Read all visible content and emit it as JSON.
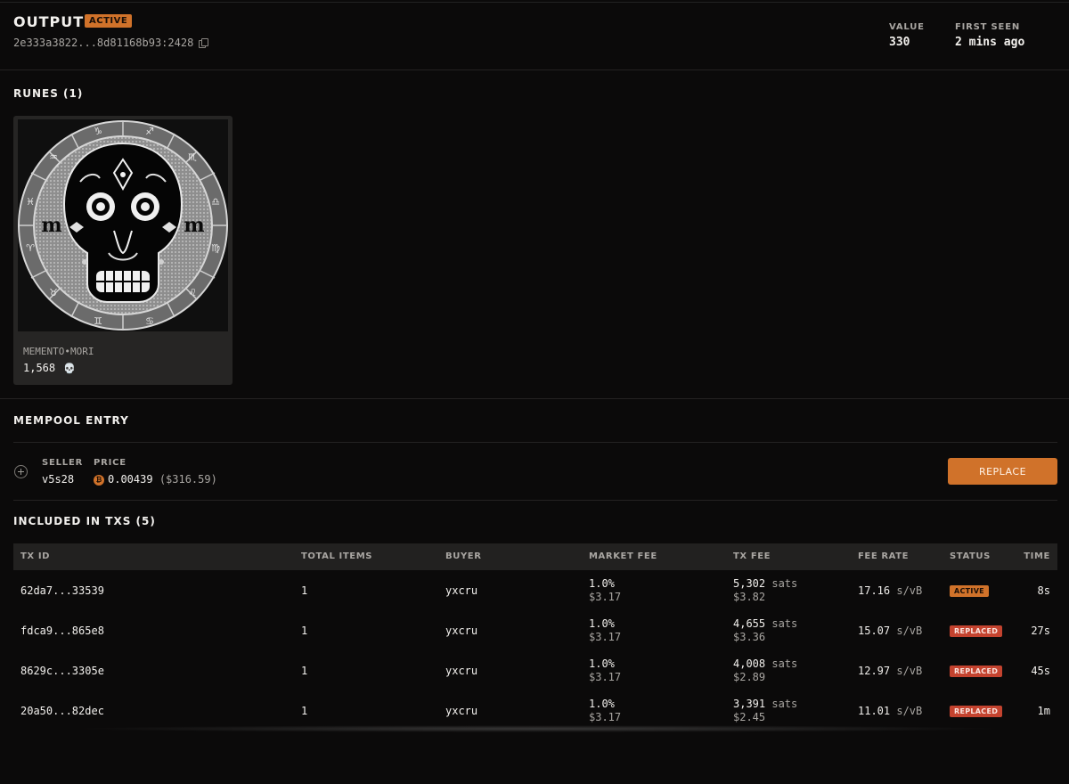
{
  "header": {
    "title": "OUTPUT",
    "status": "ACTIVE",
    "address": "2e333a3822...8d81168b93:2428",
    "value_label": "VALUE",
    "value": "330",
    "first_seen_label": "FIRST SEEN",
    "first_seen": "2 mins ago"
  },
  "runes": {
    "title": "RUNES (1)",
    "items": [
      {
        "name": "MEMENTO•MORI",
        "amount": "1,568",
        "symbol": "💀"
      }
    ]
  },
  "mempool": {
    "title": "MEMPOOL ENTRY",
    "seller_label": "SELLER",
    "seller": "v5s28",
    "price_label": "PRICE",
    "price_btc": "0.00439",
    "price_usd": "($316.59)",
    "replace_label": "REPLACE"
  },
  "txs": {
    "title": "INCLUDED IN TXS (5)",
    "columns": [
      "TX ID",
      "TOTAL ITEMS",
      "BUYER",
      "MARKET FEE",
      "TX FEE",
      "FEE RATE",
      "STATUS",
      "TIME"
    ],
    "rows": [
      {
        "tx_id": "62da7...33539",
        "total_items": "1",
        "buyer": "yxcru",
        "market_fee_pct": "1.0%",
        "market_fee_usd": "$3.17",
        "tx_fee_sats": "5,302",
        "tx_fee_unit": "sats",
        "tx_fee_usd": "$3.82",
        "fee_rate": "17.16",
        "fee_rate_unit": "s/vB",
        "status": "ACTIVE",
        "time": "8s"
      },
      {
        "tx_id": "fdca9...865e8",
        "total_items": "1",
        "buyer": "yxcru",
        "market_fee_pct": "1.0%",
        "market_fee_usd": "$3.17",
        "tx_fee_sats": "4,655",
        "tx_fee_unit": "sats",
        "tx_fee_usd": "$3.36",
        "fee_rate": "15.07",
        "fee_rate_unit": "s/vB",
        "status": "REPLACED",
        "time": "27s"
      },
      {
        "tx_id": "8629c...3305e",
        "total_items": "1",
        "buyer": "yxcru",
        "market_fee_pct": "1.0%",
        "market_fee_usd": "$3.17",
        "tx_fee_sats": "4,008",
        "tx_fee_unit": "sats",
        "tx_fee_usd": "$2.89",
        "fee_rate": "12.97",
        "fee_rate_unit": "s/vB",
        "status": "REPLACED",
        "time": "45s"
      },
      {
        "tx_id": "20a50...82dec",
        "total_items": "1",
        "buyer": "yxcru",
        "market_fee_pct": "1.0%",
        "market_fee_usd": "$3.17",
        "tx_fee_sats": "3,391",
        "tx_fee_unit": "sats",
        "tx_fee_usd": "$2.45",
        "fee_rate": "11.01",
        "fee_rate_unit": "s/vB",
        "status": "REPLACED",
        "time": "1m"
      }
    ]
  },
  "colors": {
    "accent": "#d0722a",
    "replaced": "#c4432f",
    "background": "#0b0a0a"
  },
  "icons": [
    "copy-icon",
    "skull-icon",
    "plus-circle-icon",
    "bitcoin-icon"
  ]
}
